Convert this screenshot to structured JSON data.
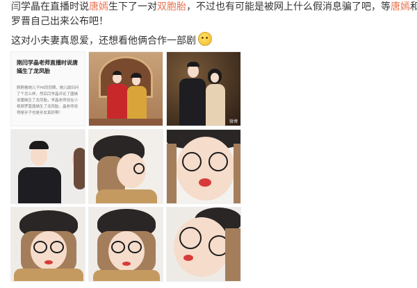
{
  "post": {
    "line1": {
      "p1": "闫学晶在直播时说",
      "link1": "唐嫣",
      "p2": "生下了一对",
      "link2": "双胞胎",
      "p3": "，不过也有可能是被网上什么假消息骗了吧，等",
      "link3": "唐嫣",
      "p4": "和"
    },
    "line2": "罗晋自己出来公布吧！",
    "line3": "这对小夫妻真恩爱，还想看他俩合作一部剧",
    "emoji": "laugh-emoji"
  },
  "news_card": {
    "title": "刚闫学晶老师直播时说唐嫣生了龙凤胎",
    "body": "刚刚看她儿子PK同同期，她儿媳妇问了个怎么样，然后闫学晶评论了唐嫣说唐嫣生了龙凤胎，学晶老师说在小视频罗晋唐嫣生了龙凤胎，晶老师说得是孙子也是孙女真好啊！"
  },
  "photo_watermark": "微博",
  "colors": {
    "link": "#eb7350",
    "text": "#333333"
  }
}
